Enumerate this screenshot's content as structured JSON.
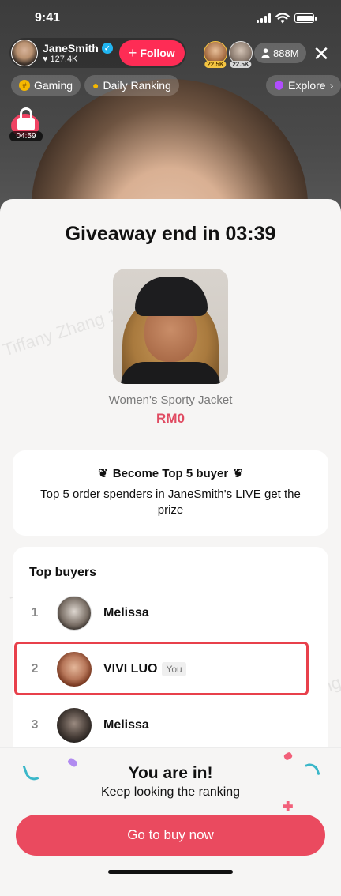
{
  "status_bar": {
    "time": "9:41"
  },
  "host": {
    "name": "JaneSmith",
    "likes": "127.4K",
    "follow_label": "Follow"
  },
  "viewers": [
    {
      "badge": "22.5K"
    },
    {
      "badge": "22.5K"
    }
  ],
  "viewer_count": "888M",
  "chips": {
    "gaming": "Gaming",
    "daily_ranking": "Daily Ranking",
    "explore": "Explore"
  },
  "lock_timer": "04:59",
  "giveaway": {
    "title": "Giveaway end in 03:39",
    "product_name": "Women's Sporty Jacket",
    "price": "RM0"
  },
  "rule": {
    "title": "Become Top 5 buyer",
    "description": "Top 5 order spenders in JaneSmith's LIVE get the prize"
  },
  "buyers": {
    "title": "Top buyers",
    "list": [
      {
        "rank": "1",
        "name": "Melissa"
      },
      {
        "rank": "2",
        "name": "VIVI LUO",
        "badge": "You"
      },
      {
        "rank": "3",
        "name": "Melissa"
      }
    ]
  },
  "footer": {
    "title": "You are in!",
    "subtitle": "Keep looking the ranking",
    "button_label": "Go to buy now"
  },
  "watermark": "Tiffany Zhang 1948",
  "colors": {
    "accent": "#fe2c55",
    "button": "#ea4a5f",
    "price": "#e04b62",
    "highlight": "#e8404b"
  }
}
